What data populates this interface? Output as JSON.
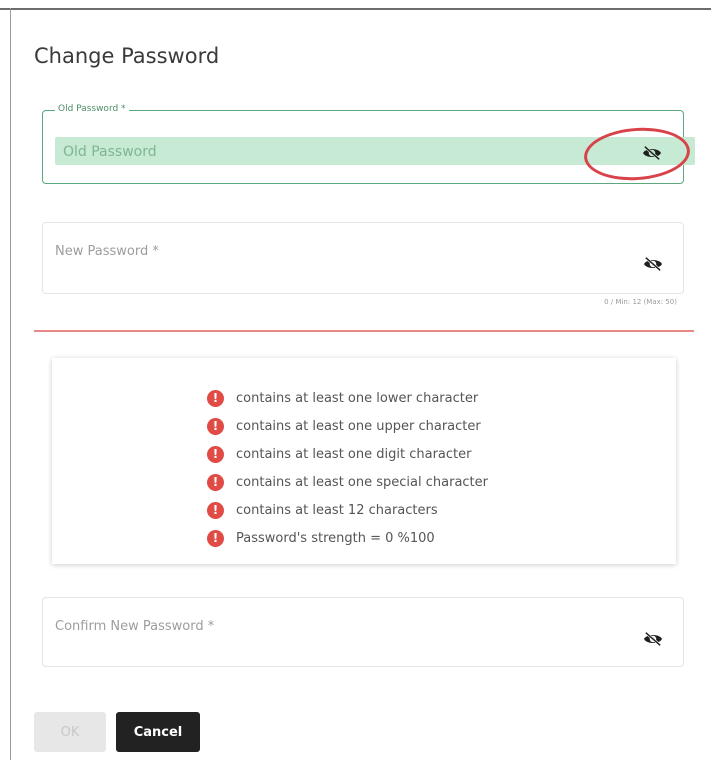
{
  "dialog": {
    "title": "Change Password"
  },
  "old_password": {
    "label": "Old Password *",
    "placeholder": "Old Password",
    "visibility_icon": "eye-off-icon"
  },
  "new_password": {
    "placeholder": "New Password *",
    "counter": "0 / Min: 12 (Max: 50)",
    "visibility_icon": "eye-off-icon"
  },
  "requirements": {
    "status_icon": "error-icon",
    "status_color": "#e04b45",
    "items": [
      "contains at least one lower character",
      "contains at least one upper character",
      "contains at least one digit character",
      "contains at least one special character",
      "contains at least 12 characters",
      "Password's strength = 0 %100"
    ]
  },
  "confirm_password": {
    "placeholder": "Confirm New Password *",
    "visibility_icon": "eye-off-icon"
  },
  "buttons": {
    "ok": "OK",
    "cancel": "Cancel"
  },
  "colors": {
    "accent_green": "#5aa87c",
    "field_fill": "#c6ead3",
    "error_line": "#e98a89",
    "highlight_ring": "#d8434a"
  }
}
